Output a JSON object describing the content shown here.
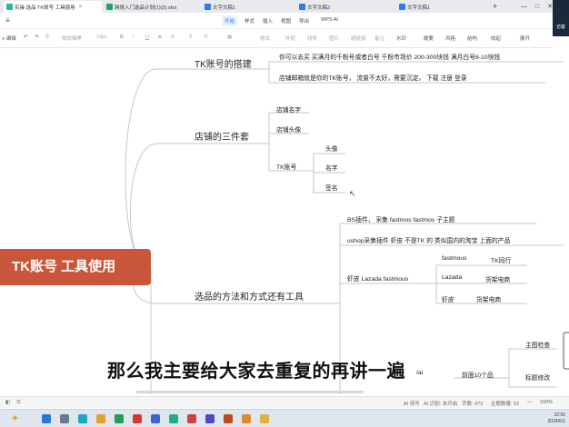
{
  "tabs": [
    {
      "label": "实操 选品 TK账号 工具使用",
      "color": "#2bb3a3",
      "active": true
    },
    {
      "label": "跨境入门选品计划(1)(2).xlsx",
      "color": "#21a464",
      "active": false
    },
    {
      "label": "文字文稿1",
      "color": "#2b7de9",
      "active": false
    },
    {
      "label": "文字文稿2",
      "color": "#2b7de9",
      "active": false
    },
    {
      "label": "文字文稿1",
      "color": "#2b7de9",
      "active": false
    }
  ],
  "menus": [
    "开始",
    "样式",
    "插入",
    "视图",
    "导出",
    "WPS AI"
  ],
  "toolbar": {
    "left": "≡ 编辑",
    "font": "微软雅黑",
    "size": "14px",
    "items": [
      "B",
      "I",
      "U",
      "S",
      "A",
      "格式",
      "外框",
      "线条",
      "图片",
      "超链接",
      "备注",
      "水印",
      "概要",
      "风格",
      "结构",
      "收起",
      "展开"
    ]
  },
  "window": {
    "min": "—",
    "max": "□",
    "close": "✕",
    "new_tab": "+"
  },
  "avatar_label": "访客",
  "mindmap": {
    "central": "TK账号  工具使用",
    "branches": [
      {
        "title": "TK账号的搭建"
      },
      {
        "title": "店铺的三件套"
      },
      {
        "title": "选品的方法和方式还有工具"
      }
    ],
    "tk_setup": {
      "line1": "你可以去买  买满月的千粉号或者白号   千粉市场价 200-300块钱   满月白号8-10块钱",
      "line2": "店铺邮箱就是你的TK账号，        流量不太好，需要沉淀，           下载  注册  登录"
    },
    "shop": {
      "name": "店铺名字",
      "avatar": "店铺头像",
      "tk": "TK账号",
      "tk_children": [
        "头像",
        "名字",
        "签名"
      ]
    },
    "selection": {
      "bs": "BS插件，         采集 fastmos         fastmos          子主题",
      "ushop": "ushop采集插件         虾皮  不是TK 的   类似国内的淘宝 上面的产品",
      "shopee": "虾皮  Lazada  fastmous",
      "sub": [
        [
          "fastmous",
          "TK同行"
        ],
        [
          "Lazada",
          "货架电商"
        ],
        [
          "虾皮",
          "货架电商"
        ]
      ],
      "right": [
        "主图检查",
        "前面10个品",
        "标题修改"
      ],
      "partial": "/ai"
    }
  },
  "subtitle": "那么我主要给大家去重复的再讲一遍",
  "status": {
    "ai": "AI 待写",
    "save": "AI 识别: 未开启",
    "words": "字数: 473",
    "topics": "主题数量: 52",
    "zoom": "100%"
  },
  "taskbar": {
    "time": "22:56",
    "date": "2024/6/1"
  }
}
